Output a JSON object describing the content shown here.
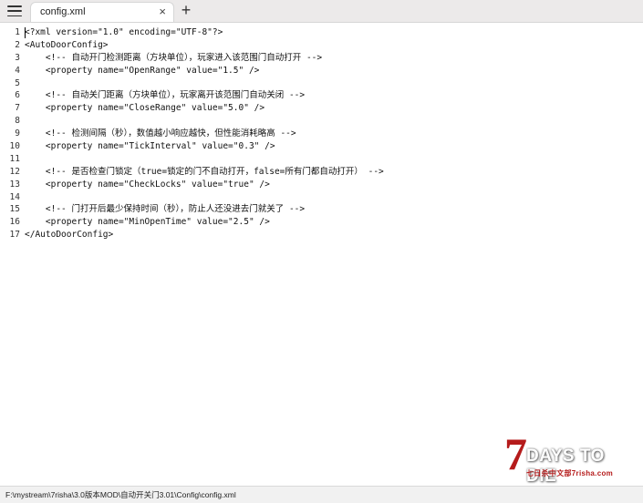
{
  "tab": {
    "title": "config.xml",
    "close_glyph": "×"
  },
  "new_tab_glyph": "+",
  "editor": {
    "line_numbers": [
      "1",
      "2",
      "3",
      "4",
      "5",
      "6",
      "7",
      "8",
      "9",
      "10",
      "11",
      "12",
      "13",
      "14",
      "15",
      "16",
      "17"
    ],
    "lines": [
      "<?xml version=\"1.0\" encoding=\"UTF-8\"?>",
      "<AutoDoorConfig>",
      "    <!-- 自动开门检测距离（方块单位），玩家进入该范围门自动打开 -->",
      "    <property name=\"OpenRange\" value=\"1.5\" />",
      "",
      "    <!-- 自动关门距离（方块单位），玩家离开该范围门自动关闭 -->",
      "    <property name=\"CloseRange\" value=\"5.0\" />",
      "",
      "    <!-- 检测间隔（秒），数值越小响应越快，但性能消耗略高 -->",
      "    <property name=\"TickInterval\" value=\"0.3\" />",
      "",
      "    <!-- 是否检查门锁定（true=锁定的门不自动打开，false=所有门都自动打开） -->",
      "    <property name=\"CheckLocks\" value=\"true\" />",
      "",
      "    <!-- 门打开后最少保持时间（秒），防止人还没进去门就关了 -->",
      "    <property name=\"MinOpenTime\" value=\"2.5\" />",
      "</AutoDoorConfig>"
    ]
  },
  "status": {
    "path": "F:\\mystream\\7risha\\3.0版本MOD\\自动开关门3.01\\Config\\config.xml"
  },
  "watermark": {
    "number": "7",
    "title": "DAYS TO DIE",
    "subtitle": "七日杀中文部7risha.com"
  },
  "icons": {
    "menu": "hamburger-menu-icon",
    "close": "close-icon",
    "add": "plus-icon"
  },
  "colors": {
    "titlebar": "#eceaea",
    "editor_bg": "#ffffff",
    "statusbar": "#f1f1f1",
    "brand_red": "#b51b1b"
  }
}
